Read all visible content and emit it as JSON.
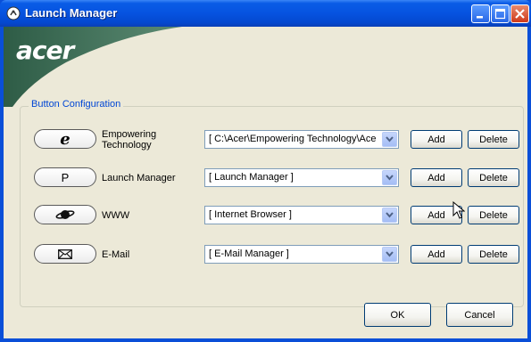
{
  "window": {
    "title": "Launch Manager",
    "brand": "acer",
    "colors": {
      "titlebar": "#0653e0",
      "brand_green": "#3a6b52",
      "group_label": "#0046d5"
    }
  },
  "group": {
    "label": "Button Configuration"
  },
  "rows": [
    {
      "button_face": "e",
      "button_icon": "ie-e-icon",
      "label_line1": "Empowering",
      "label_line2": "Technology",
      "combo_value": "[ C:\\Acer\\Empowering Technology\\Acer",
      "add_label": "Add",
      "delete_label": "Delete"
    },
    {
      "button_face": "P",
      "button_icon": "letter-p",
      "label_line1": "Launch Manager",
      "combo_value": "[ Launch Manager ]",
      "add_label": "Add",
      "delete_label": "Delete"
    },
    {
      "button_face": "",
      "button_icon": "planet-icon",
      "label_line1": "WWW",
      "combo_value": "[ Internet Browser ]",
      "add_label": "Add",
      "delete_label": "Delete"
    },
    {
      "button_face": "",
      "button_icon": "envelope-icon",
      "label_line1": "E-Mail",
      "combo_value": "[ E-Mail Manager ]",
      "add_label": "Add",
      "delete_label": "Delete"
    }
  ],
  "footer": {
    "ok_label": "OK",
    "cancel_label": "Cancel"
  }
}
